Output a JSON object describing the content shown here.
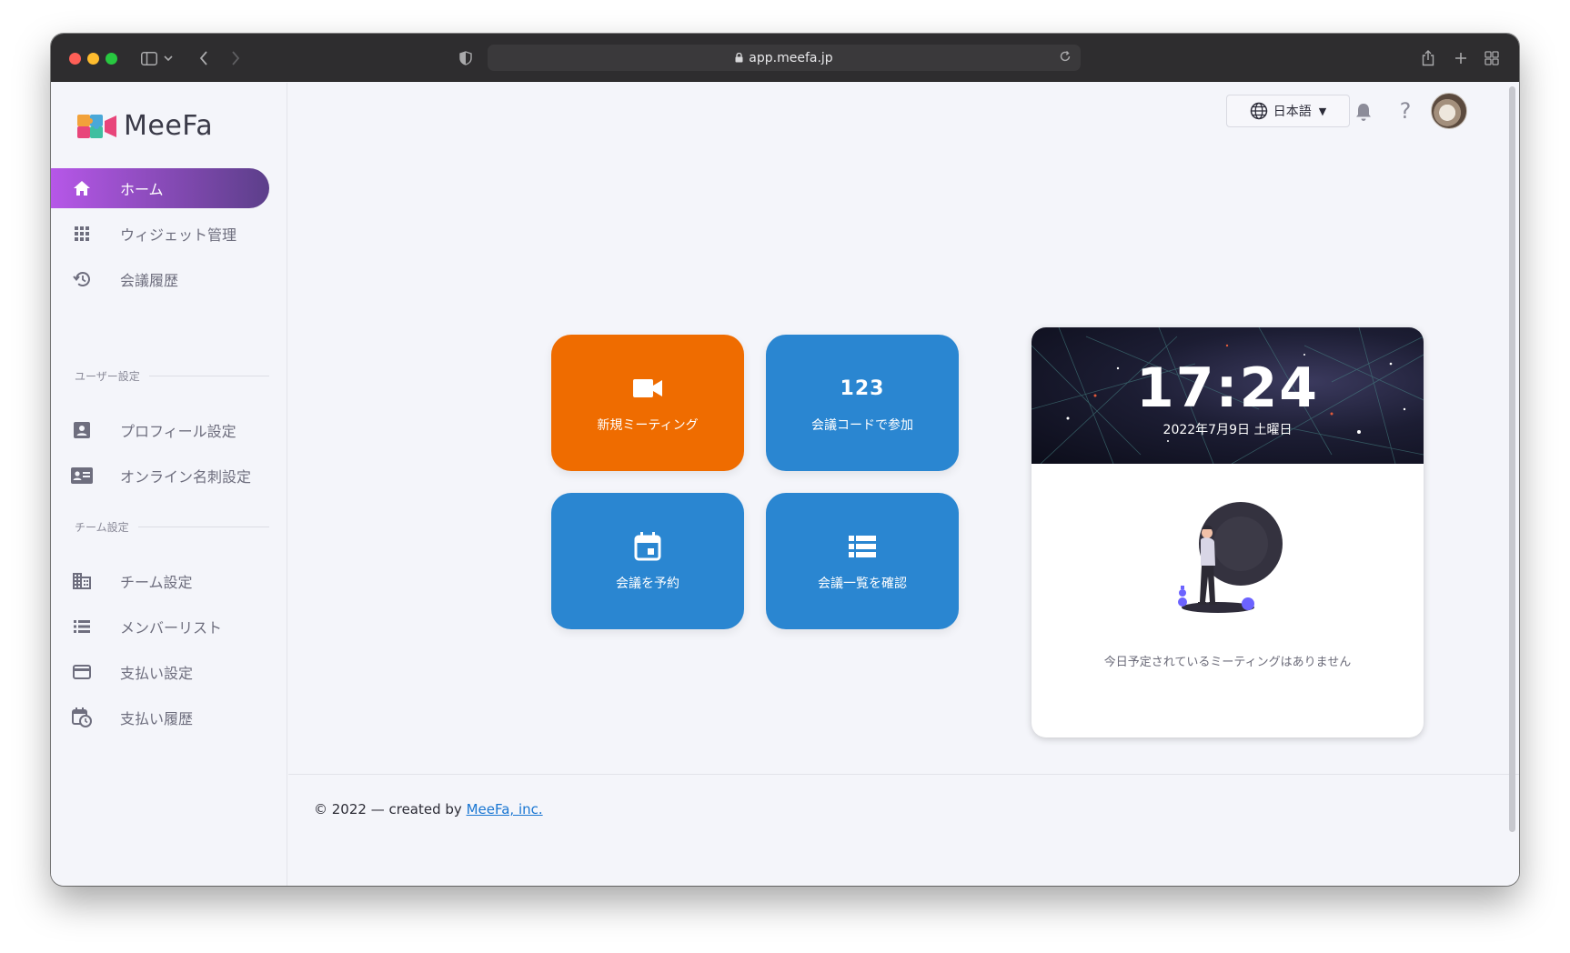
{
  "browser": {
    "url": "app.meefa.jp"
  },
  "app": {
    "name": "MeeFa"
  },
  "sidebar": {
    "items": [
      {
        "label": "ホーム",
        "icon": "home-icon",
        "active": true
      },
      {
        "label": "ウィジェット管理",
        "icon": "grid-icon"
      },
      {
        "label": "会議履歴",
        "icon": "history-icon"
      }
    ],
    "sections": [
      {
        "title": "ユーザー設定",
        "items": [
          {
            "label": "プロフィール設定",
            "icon": "account-box-icon"
          },
          {
            "label": "オンライン名刺設定",
            "icon": "business-card-icon"
          }
        ]
      },
      {
        "title": "チーム設定",
        "items": [
          {
            "label": "チーム設定",
            "icon": "building-icon"
          },
          {
            "label": "メンバーリスト",
            "icon": "list-icon"
          },
          {
            "label": "支払い設定",
            "icon": "credit-card-icon"
          },
          {
            "label": "支払い履歴",
            "icon": "calendar-clock-icon"
          }
        ]
      }
    ]
  },
  "header": {
    "language": "日本語"
  },
  "tiles": [
    {
      "label": "新規ミーティング",
      "icon": "video-camera-icon",
      "color": "#ef6c00"
    },
    {
      "label": "会議コードで参加",
      "icon": "numbers-icon",
      "glyph": "123",
      "color": "#2a86d1"
    },
    {
      "label": "会議を予約",
      "icon": "calendar-icon",
      "color": "#2a86d1"
    },
    {
      "label": "会議一覧を確認",
      "icon": "list-icon",
      "color": "#2a86d1"
    }
  ],
  "clock": {
    "time": "17:24",
    "date": "2022年7月9日 土曜日",
    "empty_message": "今日予定されているミーティングはありません"
  },
  "footer": {
    "prefix": "© 2022 — created by",
    "link": "MeeFa, inc."
  }
}
